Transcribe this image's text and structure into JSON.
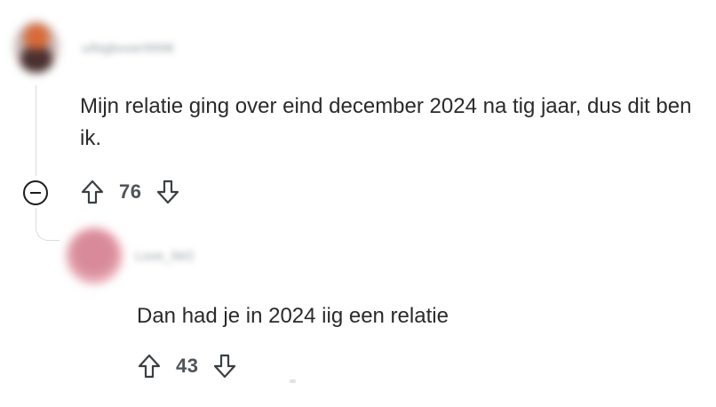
{
  "comments": [
    {
      "username": "u/bigboxer9998",
      "text": "Mijn relatie ging over eind december 2024 na tig jaar, dus dit ben ik.",
      "votes": "76"
    },
    {
      "username": "Love_lW2",
      "text": "Dan had je in 2024 iig een relatie",
      "votes": "43"
    }
  ],
  "icons": {
    "collapse": "minus-circle-icon",
    "upvote": "arrow-up-icon",
    "downvote": "arrow-down-icon"
  },
  "colors": {
    "text": "#2a2a2a",
    "muted": "#4f5458",
    "thread": "#d9dcde"
  }
}
